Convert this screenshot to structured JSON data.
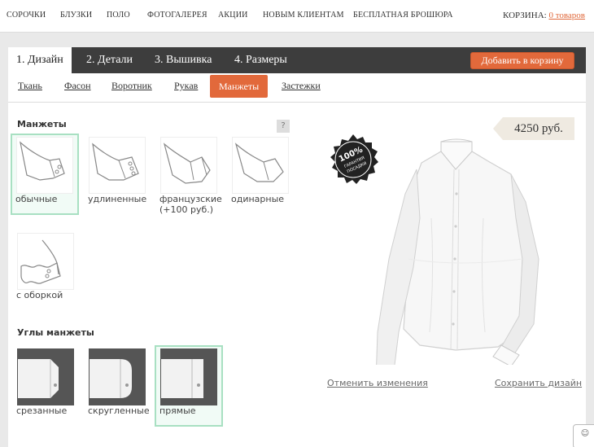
{
  "topnav": {
    "items": [
      "СОРОЧКИ",
      "БЛУЗКИ",
      "ПОЛО",
      "ФОТОГАЛЕРЕЯ",
      "АКЦИИ",
      "НОВЫМ КЛИЕНТАМ",
      "БЕСПЛАТНАЯ БРОШЮРА"
    ],
    "cart_label": "КОРЗИНА:",
    "cart_link": "0 товаров"
  },
  "tabs": [
    "1. Дизайн",
    "2. Детали",
    "3. Вышивка",
    "4. Размеры"
  ],
  "add_to_cart": "Добавить в корзину",
  "subtabs": [
    "Ткань",
    "Фасон",
    "Воротник",
    "Рукав",
    "Манжеты",
    "Застежки"
  ],
  "cuffs": {
    "title": "Манжеты",
    "help": "?",
    "options": [
      "обычные",
      "удлиненные",
      "французские (+100 руб.)",
      "одинарные",
      "с оборкой"
    ],
    "selected": "обычные"
  },
  "corners": {
    "title": "Углы манжеты",
    "options": [
      "срезанные",
      "скругленные",
      "прямые"
    ],
    "selected": "прямые"
  },
  "price": "4250 руб.",
  "badge": {
    "big": "100%",
    "line1": "ГАРАНТИЯ",
    "line2": "ПОСАДКИ"
  },
  "links": {
    "cancel": "Отменить изменения",
    "save": "Сохранить дизайн"
  },
  "colors": {
    "accent": "#e2693b",
    "tabbar": "#3d3d3d",
    "selected_border": "#a8e0c2"
  },
  "icons": {
    "cuff": "cuff-sketch-icon",
    "corner": "cuff-corner-icon",
    "badge": "guarantee-badge-icon"
  }
}
